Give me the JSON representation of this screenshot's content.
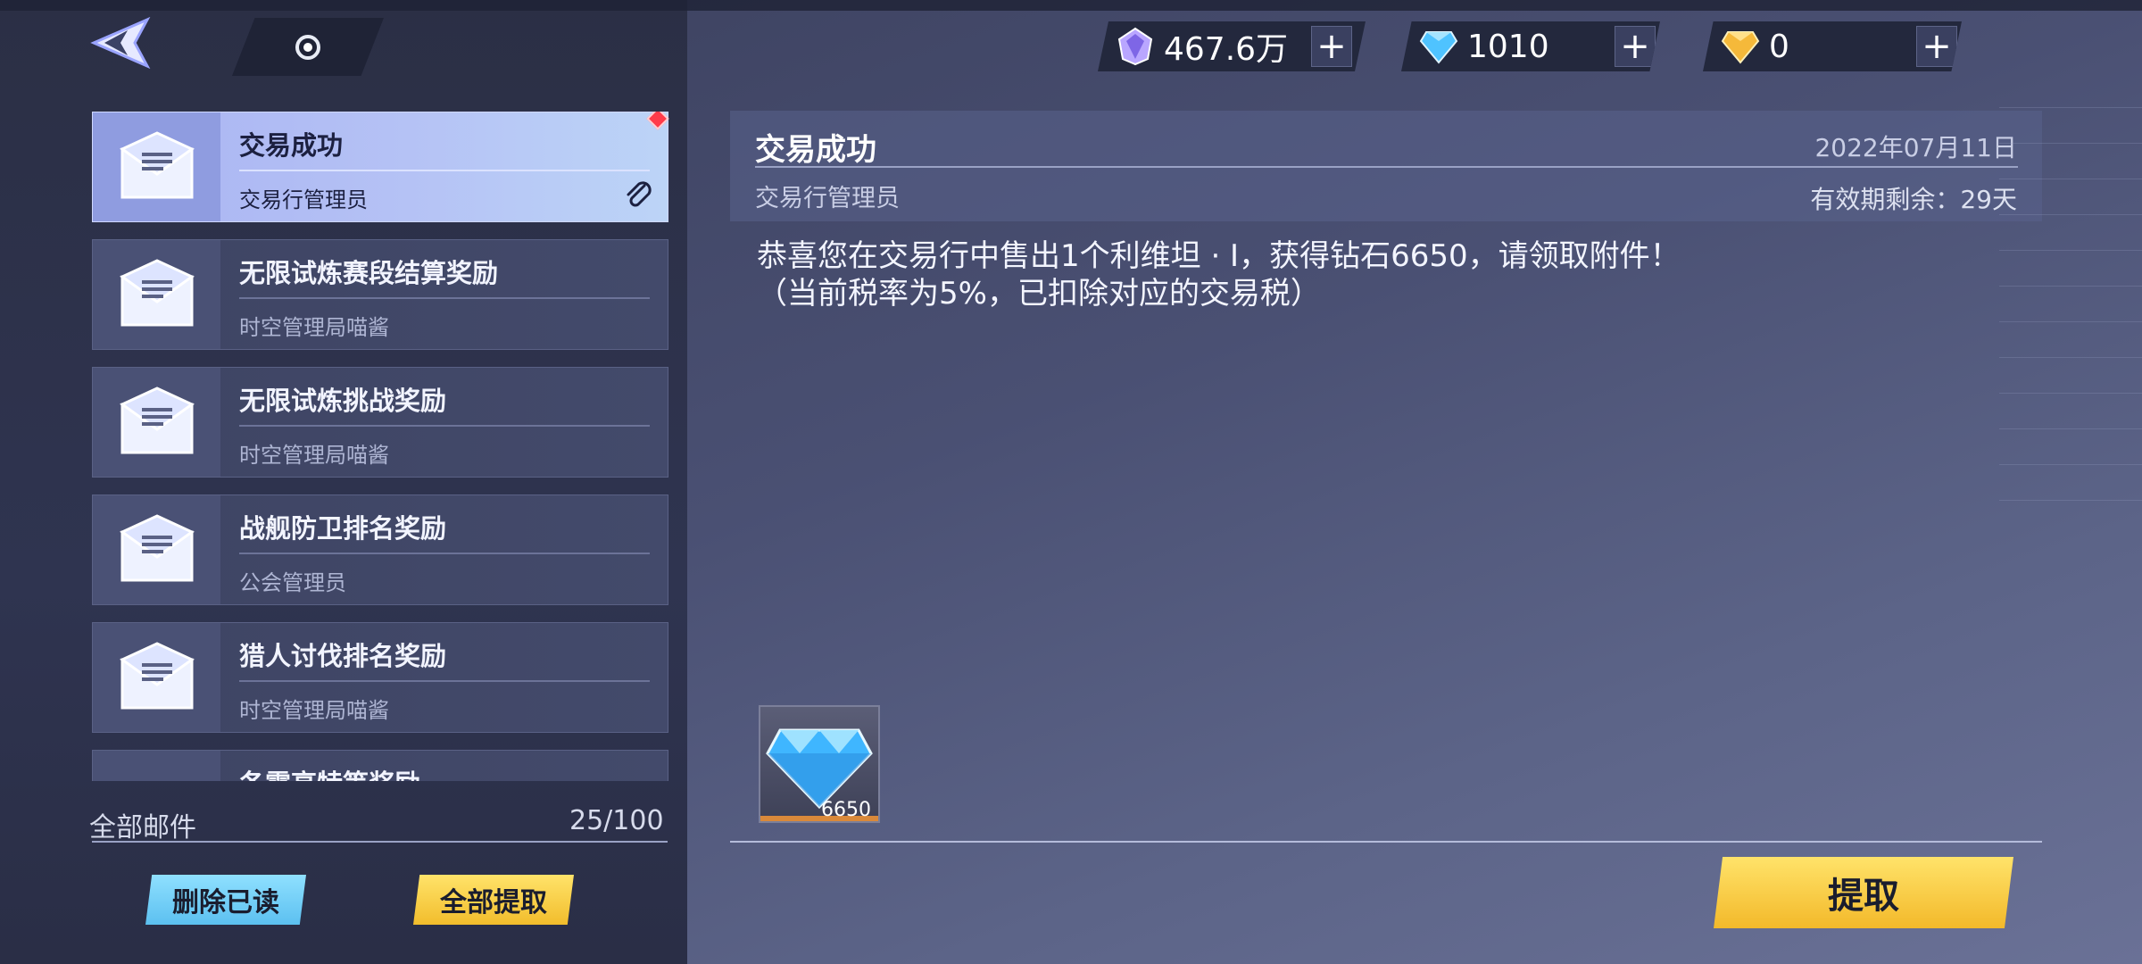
{
  "currencies": [
    {
      "icon": "purple-crystal-icon",
      "value": "467.6万"
    },
    {
      "icon": "blue-diamond-icon",
      "value": "1010"
    },
    {
      "icon": "gold-gem-icon",
      "value": "0"
    }
  ],
  "mail_list": {
    "items": [
      {
        "title": "交易成功",
        "sender": "交易行管理员"
      },
      {
        "title": "无限试炼赛段结算奖励",
        "sender": "时空管理局喵酱"
      },
      {
        "title": "无限试炼挑战奖励",
        "sender": "时空管理局喵酱"
      },
      {
        "title": "战舰防卫排名奖励",
        "sender": "公会管理员"
      },
      {
        "title": "猎人讨伐排名奖励",
        "sender": "时空管理局喵酱"
      },
      {
        "title": "各零高特等奖励",
        "sender": ""
      }
    ],
    "footer_label": "全部邮件",
    "count": "25/100"
  },
  "buttons": {
    "delete_read": "删除已读",
    "claim_all": "全部提取",
    "claim": "提取"
  },
  "detail": {
    "title": "交易成功",
    "date": "2022年07月11日",
    "sender": "交易行管理员",
    "expiry": "有效期剩余：29天",
    "body_line1": "恭喜您在交易行中售出1个利维坦 · Ⅰ，获得钻石6650，请领取附件！",
    "body_line2": "（当前税率为5%，已扣除对应的交易税）",
    "attachment": {
      "icon": "blue-diamond-icon",
      "quantity": "6650"
    }
  },
  "colors": {
    "accent_gold": "#f2bd2c",
    "accent_blue": "#5cc0f0",
    "active_mail": "#b5c2f5",
    "unread_marker": "#ff3b4a"
  }
}
